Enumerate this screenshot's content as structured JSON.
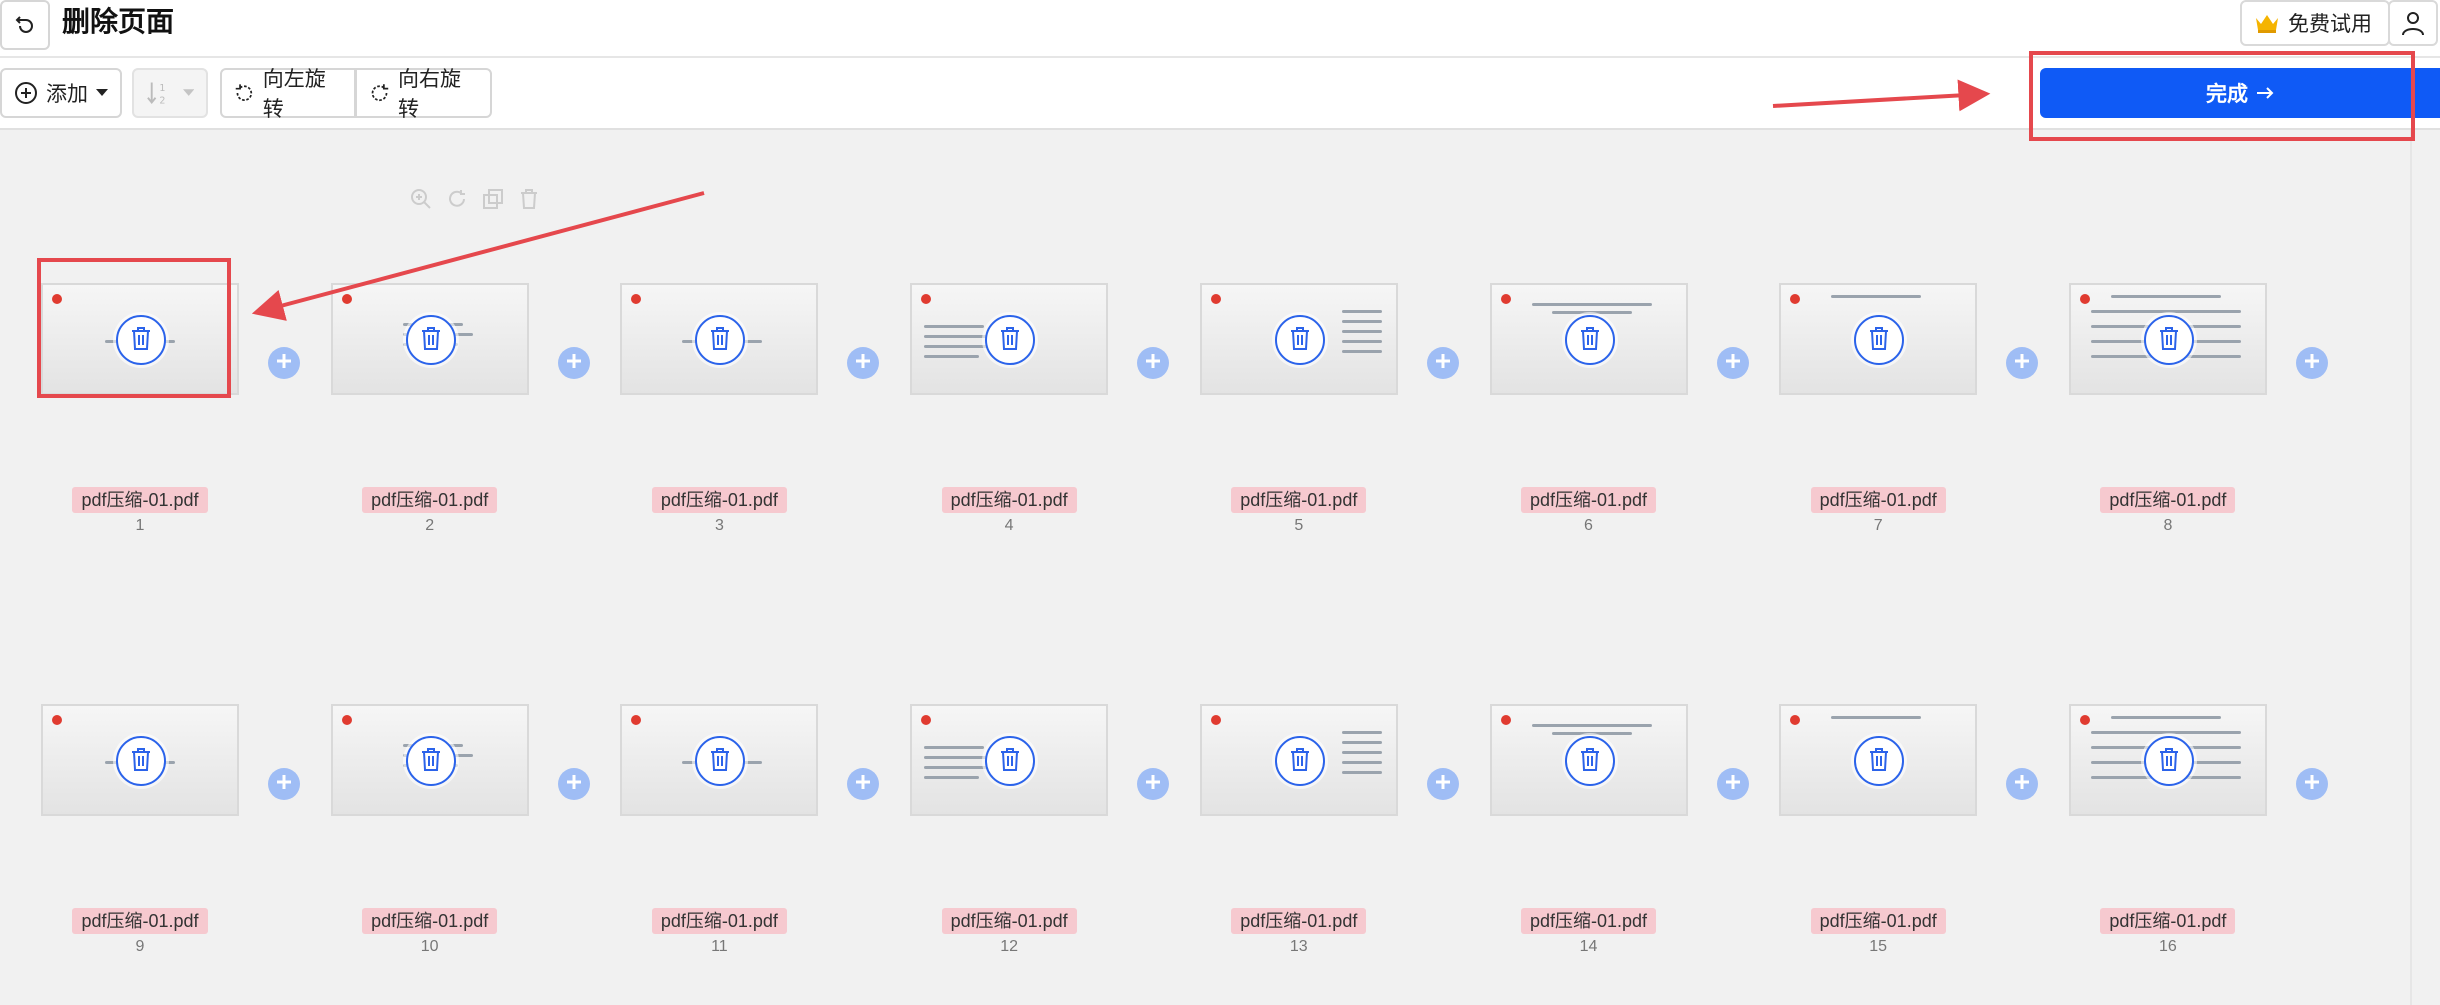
{
  "header": {
    "title": "删除页面",
    "trial_label": "免费试用"
  },
  "toolbar": {
    "add_label": "添加",
    "rotate_left_label": "向左旋转",
    "rotate_right_label": "向右旋转",
    "done_label": "完成"
  },
  "colors": {
    "accent": "#0f5af6",
    "highlight": "#e5484d",
    "filename_bg": "#f6c9cf",
    "plus_bg": "#9fbdf5"
  },
  "pages": [
    {
      "filename": "pdf压缩-01.pdf",
      "number": "1"
    },
    {
      "filename": "pdf压缩-01.pdf",
      "number": "2"
    },
    {
      "filename": "pdf压缩-01.pdf",
      "number": "3"
    },
    {
      "filename": "pdf压缩-01.pdf",
      "number": "4"
    },
    {
      "filename": "pdf压缩-01.pdf",
      "number": "5"
    },
    {
      "filename": "pdf压缩-01.pdf",
      "number": "6"
    },
    {
      "filename": "pdf压缩-01.pdf",
      "number": "7"
    },
    {
      "filename": "pdf压缩-01.pdf",
      "number": "8"
    },
    {
      "filename": "pdf压缩-01.pdf",
      "number": "9"
    },
    {
      "filename": "pdf压缩-01.pdf",
      "number": "10"
    },
    {
      "filename": "pdf压缩-01.pdf",
      "number": "11"
    },
    {
      "filename": "pdf压缩-01.pdf",
      "number": "12"
    },
    {
      "filename": "pdf压缩-01.pdf",
      "number": "13"
    },
    {
      "filename": "pdf压缩-01.pdf",
      "number": "14"
    },
    {
      "filename": "pdf压缩-01.pdf",
      "number": "15"
    },
    {
      "filename": "pdf压缩-01.pdf",
      "number": "16"
    }
  ]
}
